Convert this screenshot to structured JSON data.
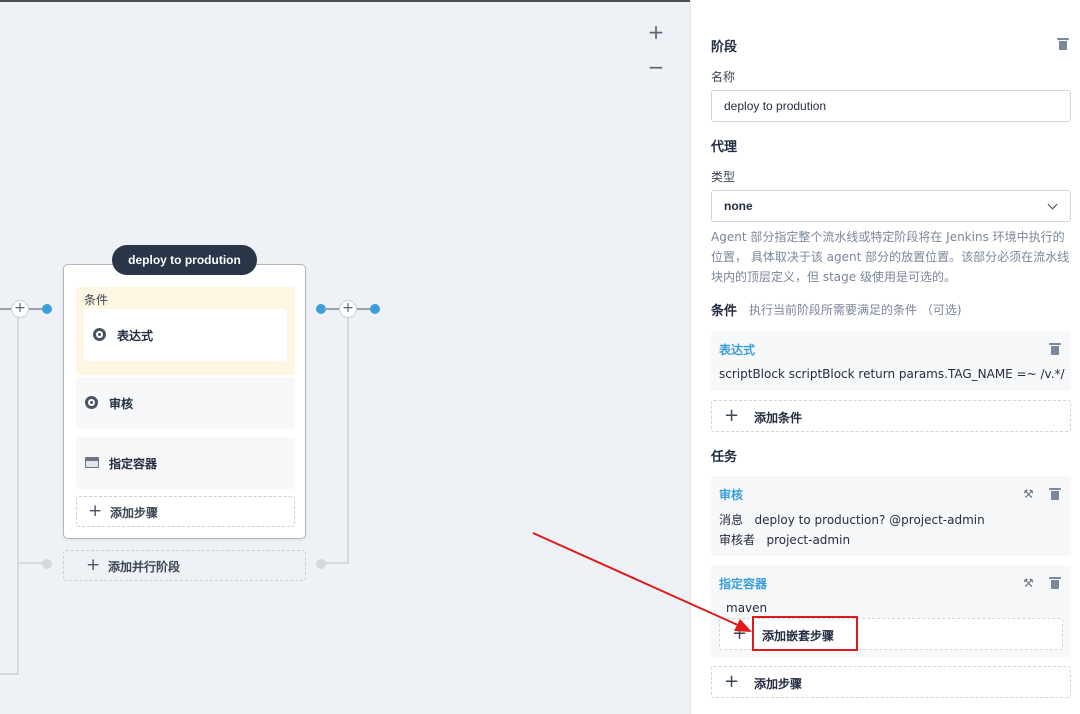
{
  "canvas": {
    "zoom_in": "+",
    "zoom_out": "−",
    "stage": {
      "title": "deploy to prodution",
      "condition_label": "条件",
      "condition_item": "表达式",
      "steps": [
        "审核",
        "指定容器"
      ],
      "add_step": "添加步骤"
    },
    "add_parallel": "添加并行阶段"
  },
  "panel": {
    "stage_heading": "阶段",
    "name_label": "名称",
    "name_value": "deploy to prodution",
    "agent_heading": "代理",
    "type_label": "类型",
    "type_value": "none",
    "agent_desc": "Agent 部分指定整个流水线或特定阶段将在 Jenkins 环境中执行的位置， 具体取决于该 agent 部分的放置位置。该部分必须在流水线块内的顶层定义，但 stage 级使用是可选的。",
    "conditions_heading": "条件",
    "conditions_sub": "执行当前阶段所需要满足的条件 （可选)",
    "condition_card": {
      "title": "表达式",
      "line": "scriptBlock   scriptBlock return params.TAG_NAME =~ /v.*/"
    },
    "add_condition": "添加条件",
    "tasks_heading": "任务",
    "review_card": {
      "title": "审核",
      "msg_label": "消息",
      "msg_value": "deploy to production? @project-admin",
      "reviewer_label": "审核者",
      "reviewer_value": "project-admin"
    },
    "container_card": {
      "title": "指定容器",
      "value": "maven",
      "add_nested": "添加嵌套步骤"
    },
    "add_step": "添加步骤"
  },
  "colors": {
    "accent": "#3a9fd8",
    "highlight": "#e01a1a",
    "stage_title_bg": "#2a3648"
  }
}
